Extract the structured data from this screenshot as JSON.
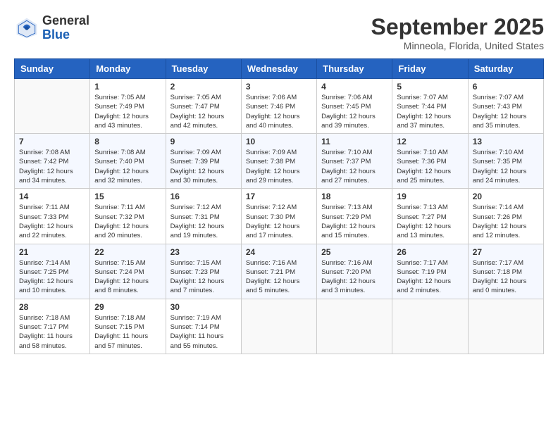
{
  "header": {
    "logo": {
      "line1": "General",
      "line2": "Blue"
    },
    "title": "September 2025",
    "subtitle": "Minneola, Florida, United States"
  },
  "days_of_week": [
    "Sunday",
    "Monday",
    "Tuesday",
    "Wednesday",
    "Thursday",
    "Friday",
    "Saturday"
  ],
  "weeks": [
    [
      {
        "day": "",
        "info": ""
      },
      {
        "day": "1",
        "info": "Sunrise: 7:05 AM\nSunset: 7:49 PM\nDaylight: 12 hours\nand 43 minutes."
      },
      {
        "day": "2",
        "info": "Sunrise: 7:05 AM\nSunset: 7:47 PM\nDaylight: 12 hours\nand 42 minutes."
      },
      {
        "day": "3",
        "info": "Sunrise: 7:06 AM\nSunset: 7:46 PM\nDaylight: 12 hours\nand 40 minutes."
      },
      {
        "day": "4",
        "info": "Sunrise: 7:06 AM\nSunset: 7:45 PM\nDaylight: 12 hours\nand 39 minutes."
      },
      {
        "day": "5",
        "info": "Sunrise: 7:07 AM\nSunset: 7:44 PM\nDaylight: 12 hours\nand 37 minutes."
      },
      {
        "day": "6",
        "info": "Sunrise: 7:07 AM\nSunset: 7:43 PM\nDaylight: 12 hours\nand 35 minutes."
      }
    ],
    [
      {
        "day": "7",
        "info": "Sunrise: 7:08 AM\nSunset: 7:42 PM\nDaylight: 12 hours\nand 34 minutes."
      },
      {
        "day": "8",
        "info": "Sunrise: 7:08 AM\nSunset: 7:40 PM\nDaylight: 12 hours\nand 32 minutes."
      },
      {
        "day": "9",
        "info": "Sunrise: 7:09 AM\nSunset: 7:39 PM\nDaylight: 12 hours\nand 30 minutes."
      },
      {
        "day": "10",
        "info": "Sunrise: 7:09 AM\nSunset: 7:38 PM\nDaylight: 12 hours\nand 29 minutes."
      },
      {
        "day": "11",
        "info": "Sunrise: 7:10 AM\nSunset: 7:37 PM\nDaylight: 12 hours\nand 27 minutes."
      },
      {
        "day": "12",
        "info": "Sunrise: 7:10 AM\nSunset: 7:36 PM\nDaylight: 12 hours\nand 25 minutes."
      },
      {
        "day": "13",
        "info": "Sunrise: 7:10 AM\nSunset: 7:35 PM\nDaylight: 12 hours\nand 24 minutes."
      }
    ],
    [
      {
        "day": "14",
        "info": "Sunrise: 7:11 AM\nSunset: 7:33 PM\nDaylight: 12 hours\nand 22 minutes."
      },
      {
        "day": "15",
        "info": "Sunrise: 7:11 AM\nSunset: 7:32 PM\nDaylight: 12 hours\nand 20 minutes."
      },
      {
        "day": "16",
        "info": "Sunrise: 7:12 AM\nSunset: 7:31 PM\nDaylight: 12 hours\nand 19 minutes."
      },
      {
        "day": "17",
        "info": "Sunrise: 7:12 AM\nSunset: 7:30 PM\nDaylight: 12 hours\nand 17 minutes."
      },
      {
        "day": "18",
        "info": "Sunrise: 7:13 AM\nSunset: 7:29 PM\nDaylight: 12 hours\nand 15 minutes."
      },
      {
        "day": "19",
        "info": "Sunrise: 7:13 AM\nSunset: 7:27 PM\nDaylight: 12 hours\nand 13 minutes."
      },
      {
        "day": "20",
        "info": "Sunrise: 7:14 AM\nSunset: 7:26 PM\nDaylight: 12 hours\nand 12 minutes."
      }
    ],
    [
      {
        "day": "21",
        "info": "Sunrise: 7:14 AM\nSunset: 7:25 PM\nDaylight: 12 hours\nand 10 minutes."
      },
      {
        "day": "22",
        "info": "Sunrise: 7:15 AM\nSunset: 7:24 PM\nDaylight: 12 hours\nand 8 minutes."
      },
      {
        "day": "23",
        "info": "Sunrise: 7:15 AM\nSunset: 7:23 PM\nDaylight: 12 hours\nand 7 minutes."
      },
      {
        "day": "24",
        "info": "Sunrise: 7:16 AM\nSunset: 7:21 PM\nDaylight: 12 hours\nand 5 minutes."
      },
      {
        "day": "25",
        "info": "Sunrise: 7:16 AM\nSunset: 7:20 PM\nDaylight: 12 hours\nand 3 minutes."
      },
      {
        "day": "26",
        "info": "Sunrise: 7:17 AM\nSunset: 7:19 PM\nDaylight: 12 hours\nand 2 minutes."
      },
      {
        "day": "27",
        "info": "Sunrise: 7:17 AM\nSunset: 7:18 PM\nDaylight: 12 hours\nand 0 minutes."
      }
    ],
    [
      {
        "day": "28",
        "info": "Sunrise: 7:18 AM\nSunset: 7:17 PM\nDaylight: 11 hours\nand 58 minutes."
      },
      {
        "day": "29",
        "info": "Sunrise: 7:18 AM\nSunset: 7:15 PM\nDaylight: 11 hours\nand 57 minutes."
      },
      {
        "day": "30",
        "info": "Sunrise: 7:19 AM\nSunset: 7:14 PM\nDaylight: 11 hours\nand 55 minutes."
      },
      {
        "day": "",
        "info": ""
      },
      {
        "day": "",
        "info": ""
      },
      {
        "day": "",
        "info": ""
      },
      {
        "day": "",
        "info": ""
      }
    ]
  ]
}
